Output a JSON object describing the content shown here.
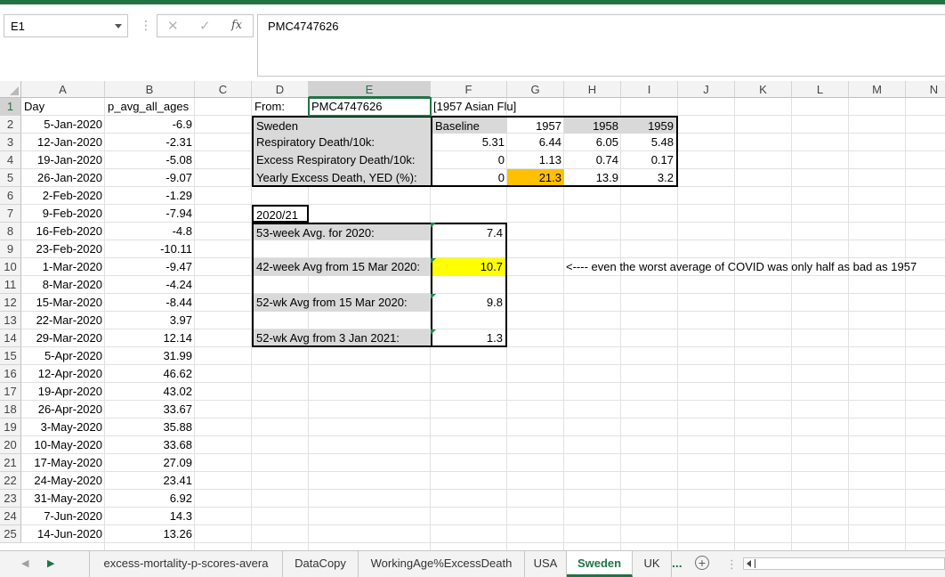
{
  "window": {
    "accent": "#217346"
  },
  "formula_bar": {
    "name_box": "E1",
    "cancel_icon": "✕",
    "enter_icon": "✓",
    "fx_label": "fx",
    "content": "PMC4747626"
  },
  "columns": [
    "A",
    "B",
    "C",
    "D",
    "E",
    "F",
    "G",
    "H",
    "I",
    "J",
    "K",
    "L",
    "M",
    "N"
  ],
  "rows": [
    "1",
    "2",
    "3",
    "4",
    "5",
    "6",
    "7",
    "8",
    "9",
    "10",
    "11",
    "12",
    "13",
    "14",
    "15",
    "16",
    "17",
    "18",
    "19",
    "20",
    "21",
    "22",
    "23",
    "24",
    "25"
  ],
  "col_a": [
    "Day",
    "5-Jan-2020",
    "12-Jan-2020",
    "19-Jan-2020",
    "26-Jan-2020",
    "2-Feb-2020",
    "9-Feb-2020",
    "16-Feb-2020",
    "23-Feb-2020",
    "1-Mar-2020",
    "8-Mar-2020",
    "15-Mar-2020",
    "22-Mar-2020",
    "29-Mar-2020",
    "5-Apr-2020",
    "12-Apr-2020",
    "19-Apr-2020",
    "26-Apr-2020",
    "3-May-2020",
    "10-May-2020",
    "17-May-2020",
    "24-May-2020",
    "31-May-2020",
    "7-Jun-2020",
    "14-Jun-2020"
  ],
  "col_b": [
    "p_avg_all_ages",
    "-6.9",
    "-2.31",
    "-5.08",
    "-9.07",
    "-1.29",
    "-7.94",
    "-4.8",
    "-10.11",
    "-9.47",
    "-4.24",
    "-8.44",
    "3.97",
    "12.14",
    "31.99",
    "46.62",
    "43.02",
    "33.67",
    "35.88",
    "33.68",
    "27.09",
    "23.41",
    "6.92",
    "14.3",
    "13.26"
  ],
  "summary": {
    "from_label": "From:",
    "from_value": "PMC4747626",
    "source_note": "[1957 Asian Flu]",
    "country": "Sweden",
    "baseline_label": "Baseline",
    "years": [
      "1957",
      "1958",
      "1959"
    ],
    "rows": [
      {
        "label": "Respiratory Death/10k:",
        "baseline": "5.31",
        "values": [
          "6.44",
          "6.05",
          "5.48"
        ]
      },
      {
        "label": "Excess Respiratory Death/10k:",
        "baseline": "0",
        "values": [
          "1.13",
          "0.74",
          "0.17"
        ]
      },
      {
        "label": "Yearly Excess Death, YED (%):",
        "baseline": "0",
        "values": [
          "21.3",
          "13.9",
          "3.2"
        ]
      }
    ]
  },
  "covid": {
    "period": "2020/21",
    "rows": [
      {
        "label": "53-week Avg. for 2020:",
        "value": "7.4"
      },
      {
        "label": "42-week Avg from 15 Mar 2020:",
        "value": "10.7"
      },
      {
        "label": "52-wk Avg from 15 Mar 2020:",
        "value": "9.8"
      },
      {
        "label": "52-wk Avg from 3 Jan 2021:",
        "value": "1.3"
      }
    ],
    "note": "<---- even the worst average of COVID was only half as bad as 1957"
  },
  "colors": {
    "highlight_orange": "#ffc000",
    "highlight_yellow": "#ffff00",
    "label_gray": "#d9d9d9"
  },
  "tabs": {
    "items": [
      "excess-mortality-p-scores-avera",
      "DataCopy",
      "WorkingAge%ExcessDeath",
      "USA",
      "Sweden",
      "UK"
    ],
    "active": "Sweden",
    "more": "...",
    "add": "+"
  }
}
